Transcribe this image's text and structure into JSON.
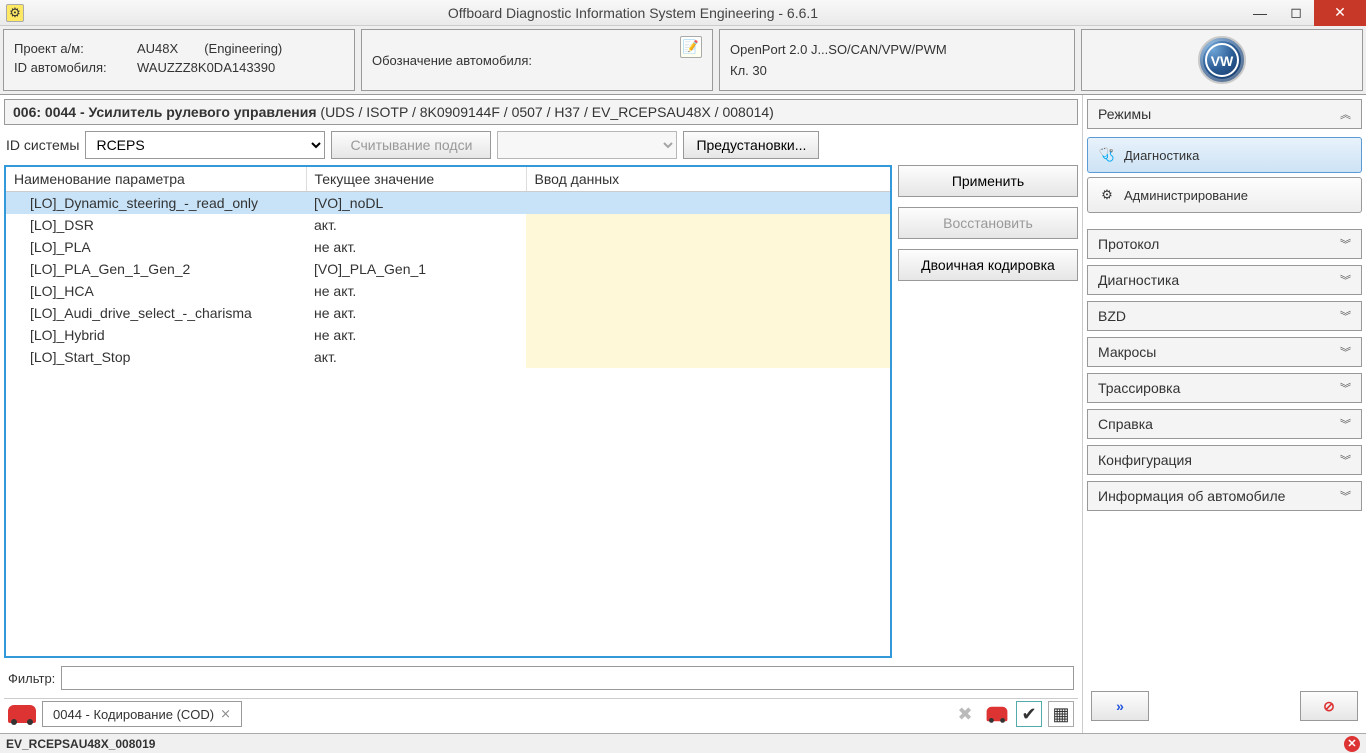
{
  "window": {
    "title": "Offboard Diagnostic Information System Engineering - 6.6.1"
  },
  "header": {
    "project_label": "Проект а/м:",
    "project_value": "AU48X",
    "project_role": "(Engineering)",
    "vehicle_id_label": "ID автомобиля:",
    "vehicle_id_value": "WAUZZZ8K0DA143390",
    "vehicle_designation_label": "Обозначение автомобиля:",
    "interface_line1": "OpenPort 2.0 J...SO/CAN/VPW/PWM",
    "interface_line2": "Кл. 30"
  },
  "module": {
    "line": "006: 0044 - Усилитель рулевого управления  (UDS / ISOTP / 8K0909144F  / 0507 / H37 / EV_RCEPSAU48X  / 008014)"
  },
  "controls": {
    "system_id_label": "ID системы",
    "system_id_value": "RCEPS",
    "read_subsys_btn": "Считывание подси",
    "presets_btn": "Предустановки...",
    "apply_btn": "Применить",
    "restore_btn": "Восстановить",
    "binary_btn": "Двоичная кодировка"
  },
  "table": {
    "col1": "Наименование параметра",
    "col2": "Текущее значение",
    "col3": "Ввод данных",
    "rows": [
      {
        "name": "[LO]_Dynamic_steering_-_read_only",
        "val": "[VO]_noDL",
        "input": "",
        "sel": true
      },
      {
        "name": "[LO]_DSR",
        "val": "акт.",
        "input": ""
      },
      {
        "name": "[LO]_PLA",
        "val": "не акт.",
        "input": ""
      },
      {
        "name": "[LO]_PLA_Gen_1_Gen_2",
        "val": "[VO]_PLA_Gen_1",
        "input": ""
      },
      {
        "name": "[LO]_HCA",
        "val": "не акт.",
        "input": ""
      },
      {
        "name": "[LO]_Audi_drive_select_-_charisma",
        "val": "не акт.",
        "input": ""
      },
      {
        "name": "[LO]_Hybrid",
        "val": "не акт.",
        "input": ""
      },
      {
        "name": "[LO]_Start_Stop",
        "val": "акт.",
        "input": ""
      }
    ]
  },
  "filter": {
    "label": "Фильтр:"
  },
  "tab": {
    "label": "0044 - Кодирование (COD)"
  },
  "sidebar": {
    "modes_title": "Режимы",
    "diag_btn": "Диагностика",
    "admin_btn": "Администрирование",
    "sections": [
      "Протокол",
      "Диагностика",
      "BZD",
      "Макросы",
      "Трассировка",
      "Справка",
      "Конфигурация",
      "Информация об автомобиле"
    ]
  },
  "status": {
    "text": "EV_RCEPSAU48X_008019"
  }
}
